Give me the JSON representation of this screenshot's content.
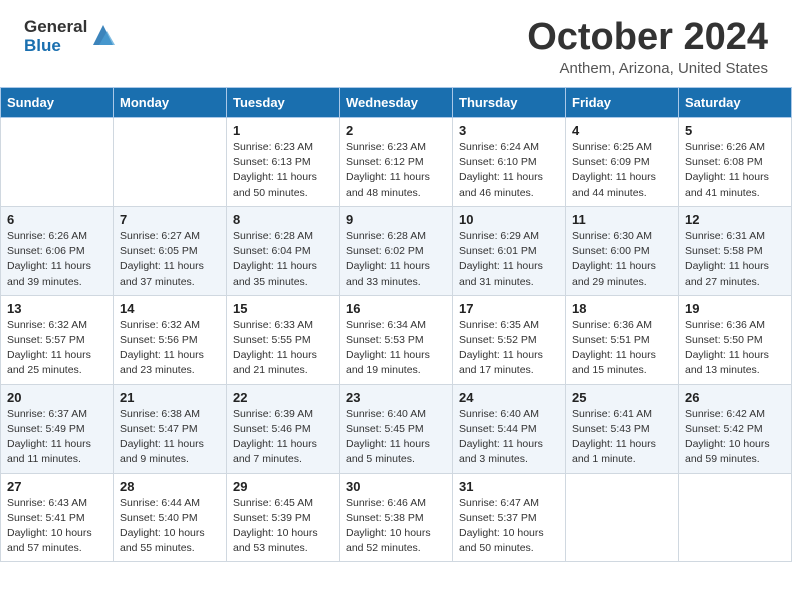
{
  "header": {
    "logo_general": "General",
    "logo_blue": "Blue",
    "month_title": "October 2024",
    "location": "Anthem, Arizona, United States"
  },
  "days_of_week": [
    "Sunday",
    "Monday",
    "Tuesday",
    "Wednesday",
    "Thursday",
    "Friday",
    "Saturday"
  ],
  "weeks": [
    [
      {
        "day": "",
        "info": ""
      },
      {
        "day": "",
        "info": ""
      },
      {
        "day": "1",
        "info": "Sunrise: 6:23 AM\nSunset: 6:13 PM\nDaylight: 11 hours and 50 minutes."
      },
      {
        "day": "2",
        "info": "Sunrise: 6:23 AM\nSunset: 6:12 PM\nDaylight: 11 hours and 48 minutes."
      },
      {
        "day": "3",
        "info": "Sunrise: 6:24 AM\nSunset: 6:10 PM\nDaylight: 11 hours and 46 minutes."
      },
      {
        "day": "4",
        "info": "Sunrise: 6:25 AM\nSunset: 6:09 PM\nDaylight: 11 hours and 44 minutes."
      },
      {
        "day": "5",
        "info": "Sunrise: 6:26 AM\nSunset: 6:08 PM\nDaylight: 11 hours and 41 minutes."
      }
    ],
    [
      {
        "day": "6",
        "info": "Sunrise: 6:26 AM\nSunset: 6:06 PM\nDaylight: 11 hours and 39 minutes."
      },
      {
        "day": "7",
        "info": "Sunrise: 6:27 AM\nSunset: 6:05 PM\nDaylight: 11 hours and 37 minutes."
      },
      {
        "day": "8",
        "info": "Sunrise: 6:28 AM\nSunset: 6:04 PM\nDaylight: 11 hours and 35 minutes."
      },
      {
        "day": "9",
        "info": "Sunrise: 6:28 AM\nSunset: 6:02 PM\nDaylight: 11 hours and 33 minutes."
      },
      {
        "day": "10",
        "info": "Sunrise: 6:29 AM\nSunset: 6:01 PM\nDaylight: 11 hours and 31 minutes."
      },
      {
        "day": "11",
        "info": "Sunrise: 6:30 AM\nSunset: 6:00 PM\nDaylight: 11 hours and 29 minutes."
      },
      {
        "day": "12",
        "info": "Sunrise: 6:31 AM\nSunset: 5:58 PM\nDaylight: 11 hours and 27 minutes."
      }
    ],
    [
      {
        "day": "13",
        "info": "Sunrise: 6:32 AM\nSunset: 5:57 PM\nDaylight: 11 hours and 25 minutes."
      },
      {
        "day": "14",
        "info": "Sunrise: 6:32 AM\nSunset: 5:56 PM\nDaylight: 11 hours and 23 minutes."
      },
      {
        "day": "15",
        "info": "Sunrise: 6:33 AM\nSunset: 5:55 PM\nDaylight: 11 hours and 21 minutes."
      },
      {
        "day": "16",
        "info": "Sunrise: 6:34 AM\nSunset: 5:53 PM\nDaylight: 11 hours and 19 minutes."
      },
      {
        "day": "17",
        "info": "Sunrise: 6:35 AM\nSunset: 5:52 PM\nDaylight: 11 hours and 17 minutes."
      },
      {
        "day": "18",
        "info": "Sunrise: 6:36 AM\nSunset: 5:51 PM\nDaylight: 11 hours and 15 minutes."
      },
      {
        "day": "19",
        "info": "Sunrise: 6:36 AM\nSunset: 5:50 PM\nDaylight: 11 hours and 13 minutes."
      }
    ],
    [
      {
        "day": "20",
        "info": "Sunrise: 6:37 AM\nSunset: 5:49 PM\nDaylight: 11 hours and 11 minutes."
      },
      {
        "day": "21",
        "info": "Sunrise: 6:38 AM\nSunset: 5:47 PM\nDaylight: 11 hours and 9 minutes."
      },
      {
        "day": "22",
        "info": "Sunrise: 6:39 AM\nSunset: 5:46 PM\nDaylight: 11 hours and 7 minutes."
      },
      {
        "day": "23",
        "info": "Sunrise: 6:40 AM\nSunset: 5:45 PM\nDaylight: 11 hours and 5 minutes."
      },
      {
        "day": "24",
        "info": "Sunrise: 6:40 AM\nSunset: 5:44 PM\nDaylight: 11 hours and 3 minutes."
      },
      {
        "day": "25",
        "info": "Sunrise: 6:41 AM\nSunset: 5:43 PM\nDaylight: 11 hours and 1 minute."
      },
      {
        "day": "26",
        "info": "Sunrise: 6:42 AM\nSunset: 5:42 PM\nDaylight: 10 hours and 59 minutes."
      }
    ],
    [
      {
        "day": "27",
        "info": "Sunrise: 6:43 AM\nSunset: 5:41 PM\nDaylight: 10 hours and 57 minutes."
      },
      {
        "day": "28",
        "info": "Sunrise: 6:44 AM\nSunset: 5:40 PM\nDaylight: 10 hours and 55 minutes."
      },
      {
        "day": "29",
        "info": "Sunrise: 6:45 AM\nSunset: 5:39 PM\nDaylight: 10 hours and 53 minutes."
      },
      {
        "day": "30",
        "info": "Sunrise: 6:46 AM\nSunset: 5:38 PM\nDaylight: 10 hours and 52 minutes."
      },
      {
        "day": "31",
        "info": "Sunrise: 6:47 AM\nSunset: 5:37 PM\nDaylight: 10 hours and 50 minutes."
      },
      {
        "day": "",
        "info": ""
      },
      {
        "day": "",
        "info": ""
      }
    ]
  ]
}
